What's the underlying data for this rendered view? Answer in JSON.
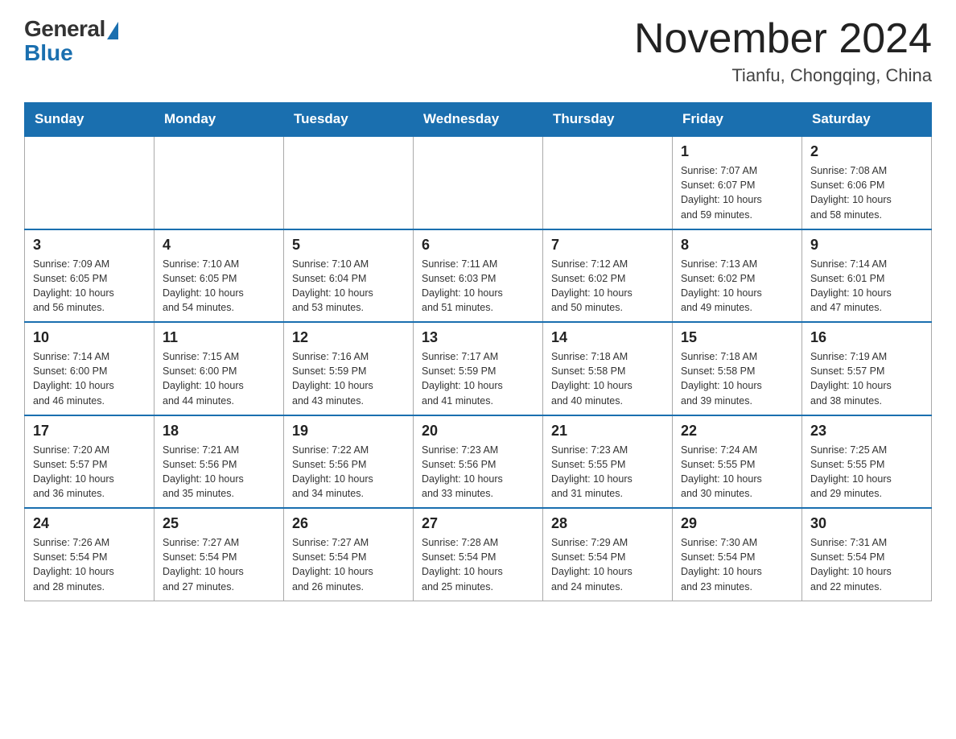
{
  "header": {
    "logo_general": "General",
    "logo_blue": "Blue",
    "month_title": "November 2024",
    "location": "Tianfu, Chongqing, China"
  },
  "days_of_week": [
    "Sunday",
    "Monday",
    "Tuesday",
    "Wednesday",
    "Thursday",
    "Friday",
    "Saturday"
  ],
  "weeks": [
    [
      {
        "day": "",
        "info": ""
      },
      {
        "day": "",
        "info": ""
      },
      {
        "day": "",
        "info": ""
      },
      {
        "day": "",
        "info": ""
      },
      {
        "day": "",
        "info": ""
      },
      {
        "day": "1",
        "info": "Sunrise: 7:07 AM\nSunset: 6:07 PM\nDaylight: 10 hours\nand 59 minutes."
      },
      {
        "day": "2",
        "info": "Sunrise: 7:08 AM\nSunset: 6:06 PM\nDaylight: 10 hours\nand 58 minutes."
      }
    ],
    [
      {
        "day": "3",
        "info": "Sunrise: 7:09 AM\nSunset: 6:05 PM\nDaylight: 10 hours\nand 56 minutes."
      },
      {
        "day": "4",
        "info": "Sunrise: 7:10 AM\nSunset: 6:05 PM\nDaylight: 10 hours\nand 54 minutes."
      },
      {
        "day": "5",
        "info": "Sunrise: 7:10 AM\nSunset: 6:04 PM\nDaylight: 10 hours\nand 53 minutes."
      },
      {
        "day": "6",
        "info": "Sunrise: 7:11 AM\nSunset: 6:03 PM\nDaylight: 10 hours\nand 51 minutes."
      },
      {
        "day": "7",
        "info": "Sunrise: 7:12 AM\nSunset: 6:02 PM\nDaylight: 10 hours\nand 50 minutes."
      },
      {
        "day": "8",
        "info": "Sunrise: 7:13 AM\nSunset: 6:02 PM\nDaylight: 10 hours\nand 49 minutes."
      },
      {
        "day": "9",
        "info": "Sunrise: 7:14 AM\nSunset: 6:01 PM\nDaylight: 10 hours\nand 47 minutes."
      }
    ],
    [
      {
        "day": "10",
        "info": "Sunrise: 7:14 AM\nSunset: 6:00 PM\nDaylight: 10 hours\nand 46 minutes."
      },
      {
        "day": "11",
        "info": "Sunrise: 7:15 AM\nSunset: 6:00 PM\nDaylight: 10 hours\nand 44 minutes."
      },
      {
        "day": "12",
        "info": "Sunrise: 7:16 AM\nSunset: 5:59 PM\nDaylight: 10 hours\nand 43 minutes."
      },
      {
        "day": "13",
        "info": "Sunrise: 7:17 AM\nSunset: 5:59 PM\nDaylight: 10 hours\nand 41 minutes."
      },
      {
        "day": "14",
        "info": "Sunrise: 7:18 AM\nSunset: 5:58 PM\nDaylight: 10 hours\nand 40 minutes."
      },
      {
        "day": "15",
        "info": "Sunrise: 7:18 AM\nSunset: 5:58 PM\nDaylight: 10 hours\nand 39 minutes."
      },
      {
        "day": "16",
        "info": "Sunrise: 7:19 AM\nSunset: 5:57 PM\nDaylight: 10 hours\nand 38 minutes."
      }
    ],
    [
      {
        "day": "17",
        "info": "Sunrise: 7:20 AM\nSunset: 5:57 PM\nDaylight: 10 hours\nand 36 minutes."
      },
      {
        "day": "18",
        "info": "Sunrise: 7:21 AM\nSunset: 5:56 PM\nDaylight: 10 hours\nand 35 minutes."
      },
      {
        "day": "19",
        "info": "Sunrise: 7:22 AM\nSunset: 5:56 PM\nDaylight: 10 hours\nand 34 minutes."
      },
      {
        "day": "20",
        "info": "Sunrise: 7:23 AM\nSunset: 5:56 PM\nDaylight: 10 hours\nand 33 minutes."
      },
      {
        "day": "21",
        "info": "Sunrise: 7:23 AM\nSunset: 5:55 PM\nDaylight: 10 hours\nand 31 minutes."
      },
      {
        "day": "22",
        "info": "Sunrise: 7:24 AM\nSunset: 5:55 PM\nDaylight: 10 hours\nand 30 minutes."
      },
      {
        "day": "23",
        "info": "Sunrise: 7:25 AM\nSunset: 5:55 PM\nDaylight: 10 hours\nand 29 minutes."
      }
    ],
    [
      {
        "day": "24",
        "info": "Sunrise: 7:26 AM\nSunset: 5:54 PM\nDaylight: 10 hours\nand 28 minutes."
      },
      {
        "day": "25",
        "info": "Sunrise: 7:27 AM\nSunset: 5:54 PM\nDaylight: 10 hours\nand 27 minutes."
      },
      {
        "day": "26",
        "info": "Sunrise: 7:27 AM\nSunset: 5:54 PM\nDaylight: 10 hours\nand 26 minutes."
      },
      {
        "day": "27",
        "info": "Sunrise: 7:28 AM\nSunset: 5:54 PM\nDaylight: 10 hours\nand 25 minutes."
      },
      {
        "day": "28",
        "info": "Sunrise: 7:29 AM\nSunset: 5:54 PM\nDaylight: 10 hours\nand 24 minutes."
      },
      {
        "day": "29",
        "info": "Sunrise: 7:30 AM\nSunset: 5:54 PM\nDaylight: 10 hours\nand 23 minutes."
      },
      {
        "day": "30",
        "info": "Sunrise: 7:31 AM\nSunset: 5:54 PM\nDaylight: 10 hours\nand 22 minutes."
      }
    ]
  ]
}
